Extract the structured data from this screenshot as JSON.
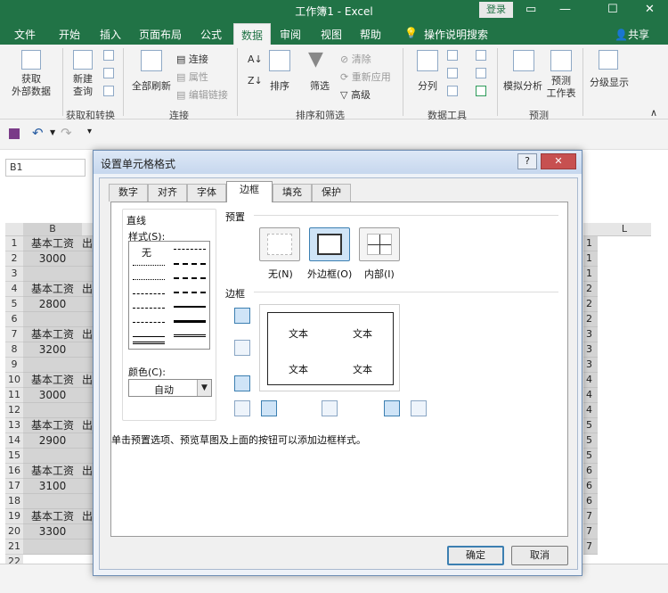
{
  "window": {
    "title": "工作簿1  -  Excel",
    "login": "登录",
    "share": "共享"
  },
  "ribbon": {
    "tabs": [
      "文件",
      "开始",
      "插入",
      "页面布局",
      "公式",
      "数据",
      "审阅",
      "视图",
      "帮助",
      "操作说明搜索"
    ],
    "active_tab": "数据",
    "buttons": {
      "get_external": "获取\n外部数据",
      "new_query": "新建\n查询",
      "refresh_all": "全部刷新",
      "connections": "连接",
      "properties": "属性",
      "edit_links": "编辑链接",
      "sort": "排序",
      "filter": "筛选",
      "clear": "清除",
      "reapply": "重新应用",
      "advanced": "高级",
      "text_to_columns": "分列",
      "what_if": "模拟分析",
      "forecast_sheet": "预测\n工作表",
      "outline": "分级显示"
    },
    "groups": [
      "获取和转换",
      "连接",
      "排序和筛选",
      "数据工具",
      "预测"
    ]
  },
  "namebox": "B1",
  "sheet": {
    "col_b": "B",
    "col_l": "L",
    "rows": [
      {
        "n": "1",
        "b": "基本工资",
        "c": "出",
        "r": "1"
      },
      {
        "n": "2",
        "b": "3000",
        "c": "",
        "r": "1"
      },
      {
        "n": "3",
        "b": "",
        "c": "",
        "r": "1"
      },
      {
        "n": "4",
        "b": "基本工资",
        "c": "出",
        "r": "2"
      },
      {
        "n": "5",
        "b": "2800",
        "c": "",
        "r": "2"
      },
      {
        "n": "6",
        "b": "",
        "c": "",
        "r": "2"
      },
      {
        "n": "7",
        "b": "基本工资",
        "c": "出",
        "r": "3"
      },
      {
        "n": "8",
        "b": "3200",
        "c": "",
        "r": "3"
      },
      {
        "n": "9",
        "b": "",
        "c": "",
        "r": "3"
      },
      {
        "n": "10",
        "b": "基本工资",
        "c": "出",
        "r": "4"
      },
      {
        "n": "11",
        "b": "3000",
        "c": "",
        "r": "4"
      },
      {
        "n": "12",
        "b": "",
        "c": "",
        "r": "4"
      },
      {
        "n": "13",
        "b": "基本工资",
        "c": "出",
        "r": "5"
      },
      {
        "n": "14",
        "b": "2900",
        "c": "",
        "r": "5"
      },
      {
        "n": "15",
        "b": "",
        "c": "",
        "r": "5"
      },
      {
        "n": "16",
        "b": "基本工资",
        "c": "出",
        "r": "6"
      },
      {
        "n": "17",
        "b": "3100",
        "c": "",
        "r": "6"
      },
      {
        "n": "18",
        "b": "",
        "c": "",
        "r": "6"
      },
      {
        "n": "19",
        "b": "基本工资",
        "c": "出",
        "r": "7"
      },
      {
        "n": "20",
        "b": "3300",
        "c": "",
        "r": "7"
      },
      {
        "n": "21",
        "b": "",
        "c": "",
        "r": "7"
      },
      {
        "n": "22",
        "b": "",
        "c": "",
        "r": ""
      }
    ]
  },
  "dialog": {
    "title": "设置单元格格式",
    "help": "?",
    "close": "✕",
    "tabs": [
      "数字",
      "对齐",
      "字体",
      "边框",
      "填充",
      "保护"
    ],
    "active_tab": "边框",
    "line_section": "直线",
    "style_label": "样式(S):",
    "style_none": "无",
    "color_label": "颜色(C):",
    "color_value": "自动",
    "presets_label": "预置",
    "presets": [
      "无(N)",
      "外边框(O)",
      "内部(I)"
    ],
    "border_label": "边框",
    "preview_text": [
      "文本",
      "文本",
      "文本",
      "文本"
    ],
    "hint": "单击预置选项、预览草图及上面的按钮可以添加边框样式。",
    "ok": "确定",
    "cancel": "取消"
  },
  "colors": {
    "excel_green": "#217346",
    "selection": "#3c7fb1"
  }
}
